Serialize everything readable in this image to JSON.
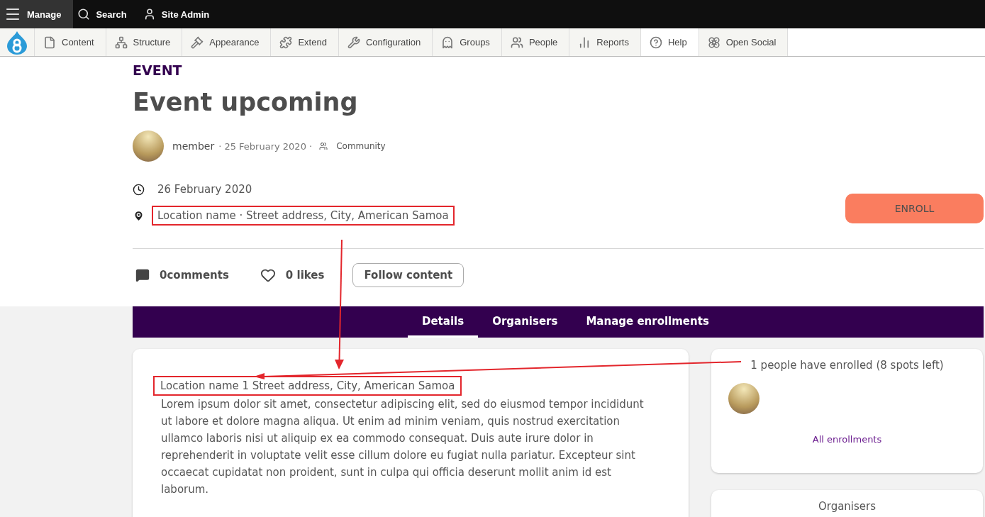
{
  "toolbar": {
    "items": [
      {
        "label": "Manage",
        "kind": "menu",
        "selected": true
      },
      {
        "label": "Search",
        "kind": "search",
        "selected": false
      },
      {
        "label": "Site Admin",
        "kind": "user",
        "selected": false
      }
    ]
  },
  "tray": {
    "items": [
      {
        "label": "Content",
        "kind": "file",
        "selected": false
      },
      {
        "label": "Structure",
        "kind": "sitemap",
        "selected": false
      },
      {
        "label": "Appearance",
        "kind": "gavel",
        "selected": false
      },
      {
        "label": "Extend",
        "kind": "puzzle",
        "selected": false
      },
      {
        "label": "Configuration",
        "kind": "wrench",
        "selected": false
      },
      {
        "label": "Groups",
        "kind": "ghost",
        "selected": false
      },
      {
        "label": "People",
        "kind": "people",
        "selected": false
      },
      {
        "label": "Reports",
        "kind": "chart",
        "selected": false
      },
      {
        "label": "Help",
        "kind": "help",
        "selected": true
      },
      {
        "label": "Open Social",
        "kind": "flower",
        "selected": false
      }
    ]
  },
  "event": {
    "type_label": "EVENT",
    "title": "Event upcoming",
    "author": "member",
    "posted": "· 25 February 2020 ·",
    "group": "Community",
    "event_date": "26 February 2020",
    "location": "Location name · Street address, City, American Samoa",
    "enroll_button": "ENROLL",
    "comments": "0comments",
    "likes": "0 likes",
    "follow_button": "Follow content"
  },
  "tabs": [
    {
      "label": "Details",
      "selected": true
    },
    {
      "label": "Organisers",
      "selected": false
    },
    {
      "label": "Manage enrollments",
      "selected": false
    }
  ],
  "details": {
    "location": "Location name 1 Street address, City, American Samoa",
    "description": "Lorem ipsum dolor sit amet, consectetur adipiscing elit, sed do eiusmod tempor incididunt ut labore et dolore magna aliqua. Ut enim ad minim veniam, quis nostrud exercitation ullamco laboris nisi ut aliquip ex ea commodo consequat. Duis aute irure dolor in reprehenderit in voluptate velit esse cillum dolore eu fugiat nulla pariatur. Excepteur sint occaecat cupidatat non proident, sunt in culpa qui officia deserunt mollit anim id est laborum."
  },
  "enrollments": {
    "summary": "1 people have enrolled (8 spots left)",
    "link": "All enrollments"
  },
  "organisers": {
    "title": "Organisers"
  }
}
